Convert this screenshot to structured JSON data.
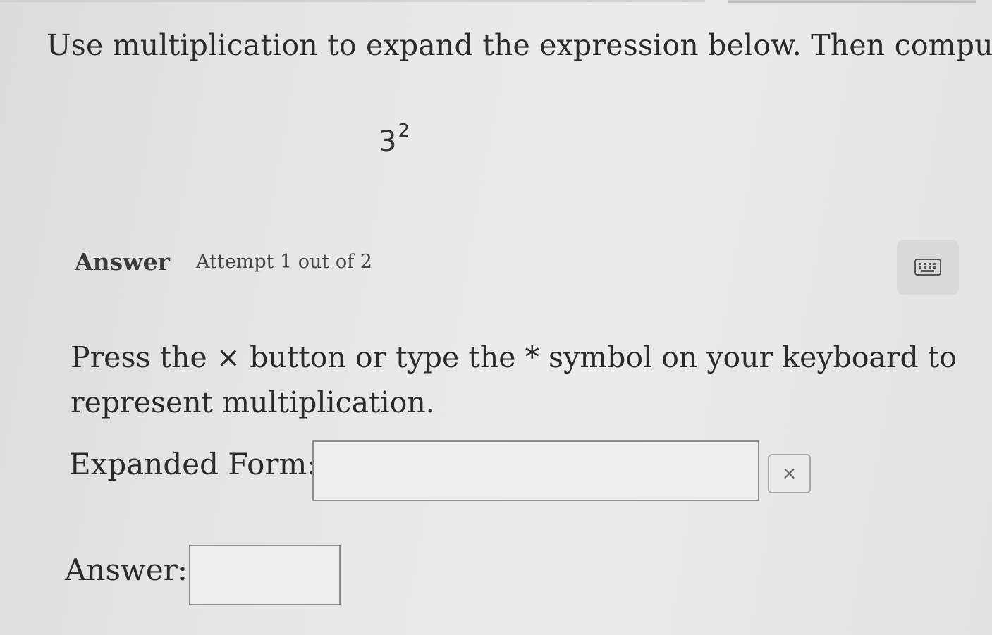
{
  "question": {
    "text": "Use multiplication to expand the expression below. Then compute."
  },
  "expression": {
    "base": "3",
    "exponent": "2"
  },
  "answer_header": {
    "title": "Answer",
    "attempt": "Attempt 1 out of 2"
  },
  "keyboard_button": {
    "icon": "keyboard-icon"
  },
  "instruction": {
    "line1": "Press the × button or type the * symbol on your keyboard to",
    "line2": "represent multiplication."
  },
  "expanded_form": {
    "label": "Expanded Form:",
    "value": "",
    "times_button_label": "×"
  },
  "answer": {
    "label": "Answer:",
    "value": ""
  }
}
